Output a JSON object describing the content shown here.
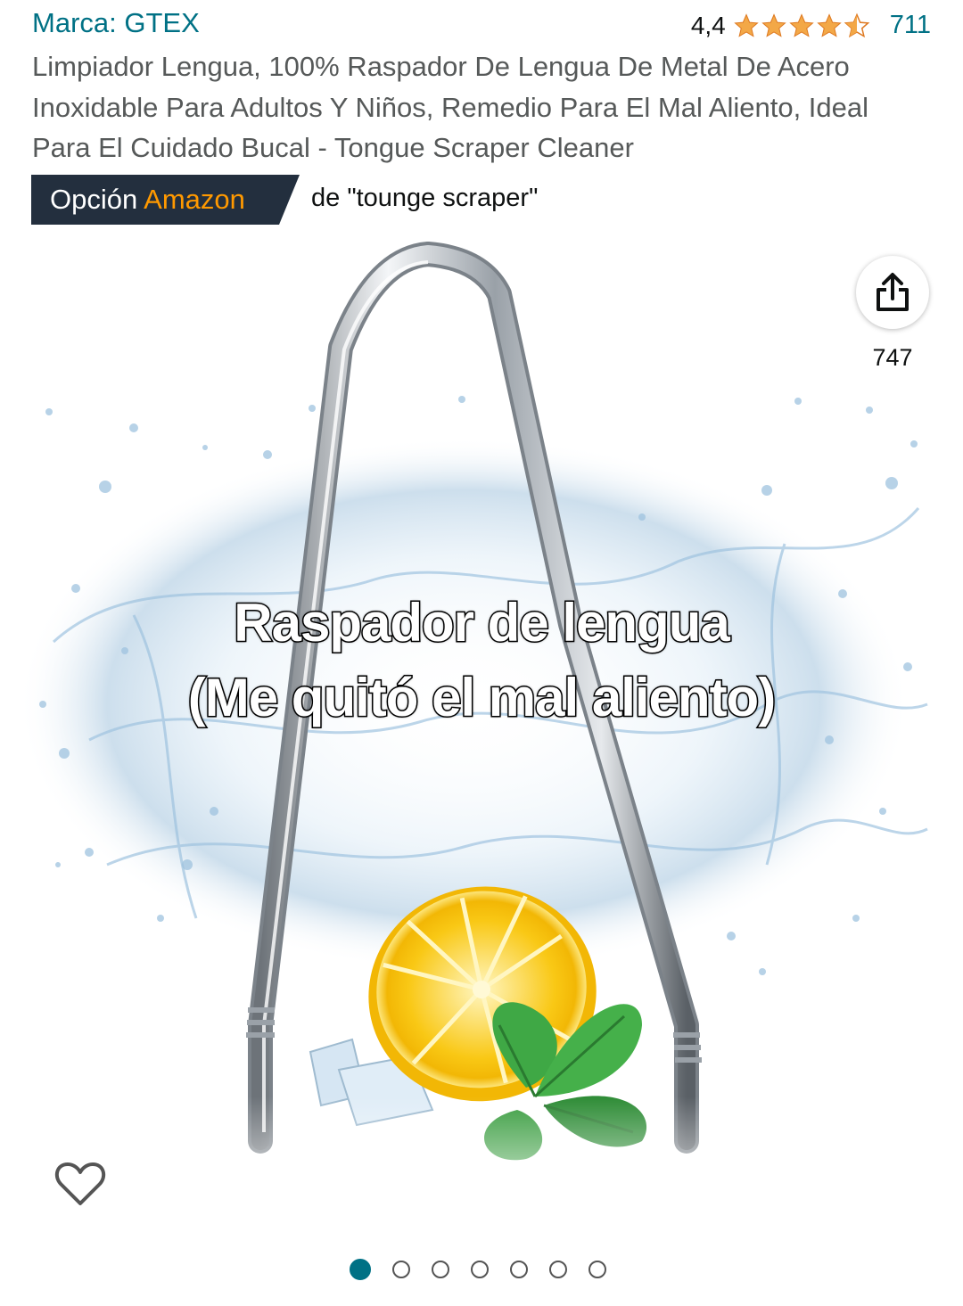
{
  "brand": "Marca: GTEX",
  "rating": {
    "value_text": "4,4",
    "value": 4.4,
    "count": "711",
    "star_color": "#f3a847"
  },
  "title": "Limpiador Lengua, 100% Raspador De Lengua De Metal De Acero Inoxidable Para Adultos Y Niños, Remedio Para El Mal Aliento, Ideal Para El Cuidado Bucal - Tongue Scraper Cleaner",
  "badge": {
    "prefix": "Opción",
    "brand": "Amazon",
    "for_text": "de \"tounge scraper\"",
    "bg_color": "#232f3e",
    "accent_color": "#ff9900"
  },
  "image": {
    "caption_line1": "Raspador de lengua",
    "caption_line2": "(Me quitó el mal aliento)",
    "share_icon": "share-icon",
    "share_count": "747",
    "favorite_icon": "heart-icon"
  },
  "carousel": {
    "total": 7,
    "active_index": 0,
    "active_color": "#007185"
  },
  "colors": {
    "link": "#007185",
    "text_secondary": "#565959"
  }
}
